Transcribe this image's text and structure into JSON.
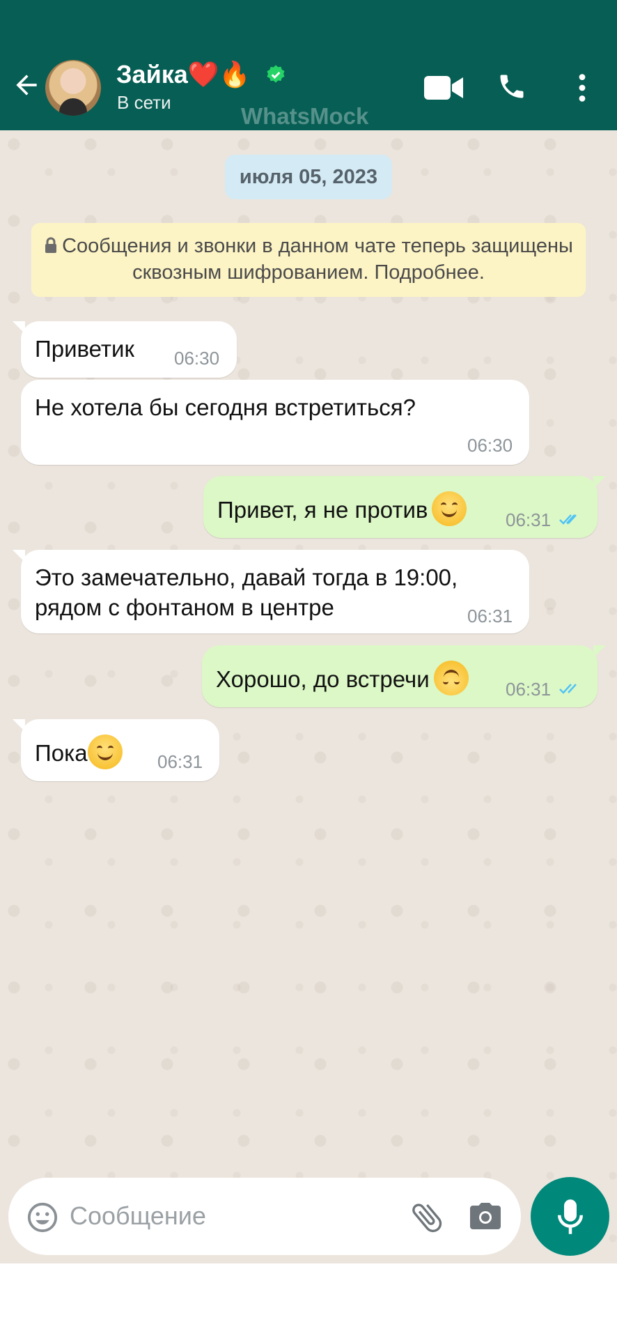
{
  "header": {
    "name": "Зайка❤️🔥",
    "status": "В сети",
    "watermark": "WhatsMock"
  },
  "chat": {
    "date": "июля 05, 2023",
    "encryption_notice": "Сообщения и звонки в данном чате теперь защищены сквозным шифрованием. Подробнее.",
    "messages": [
      {
        "direction": "in",
        "text": "Приветик",
        "time": "06:30"
      },
      {
        "direction": "in",
        "text": "Не хотела бы сегодня встретиться?",
        "time": "06:30"
      },
      {
        "direction": "out",
        "text": "Привет, я не против",
        "emoji": "smiling-face-icon",
        "time": "06:31",
        "status": "read"
      },
      {
        "direction": "in",
        "text_line1": "Это замечательно, давай тогда в 19:00,",
        "text_line2": "рядом с фонтаном в центре",
        "time": "06:31"
      },
      {
        "direction": "out",
        "text": "Хорошо, до встречи",
        "emoji": "upside-down-face-icon",
        "time": "06:31",
        "status": "read"
      },
      {
        "direction": "in",
        "text": "Пока",
        "emoji": "smiling-face-icon",
        "time": "06:31"
      }
    ]
  },
  "input": {
    "placeholder": "Сообщение",
    "value": ""
  },
  "colors": {
    "header": "#075e54",
    "chat_background": "#ece5dd",
    "incoming_bubble": "#ffffff",
    "outgoing_bubble": "#dcf8c6",
    "mic_button": "#00897b",
    "read_ticks": "#4fc3f7"
  }
}
